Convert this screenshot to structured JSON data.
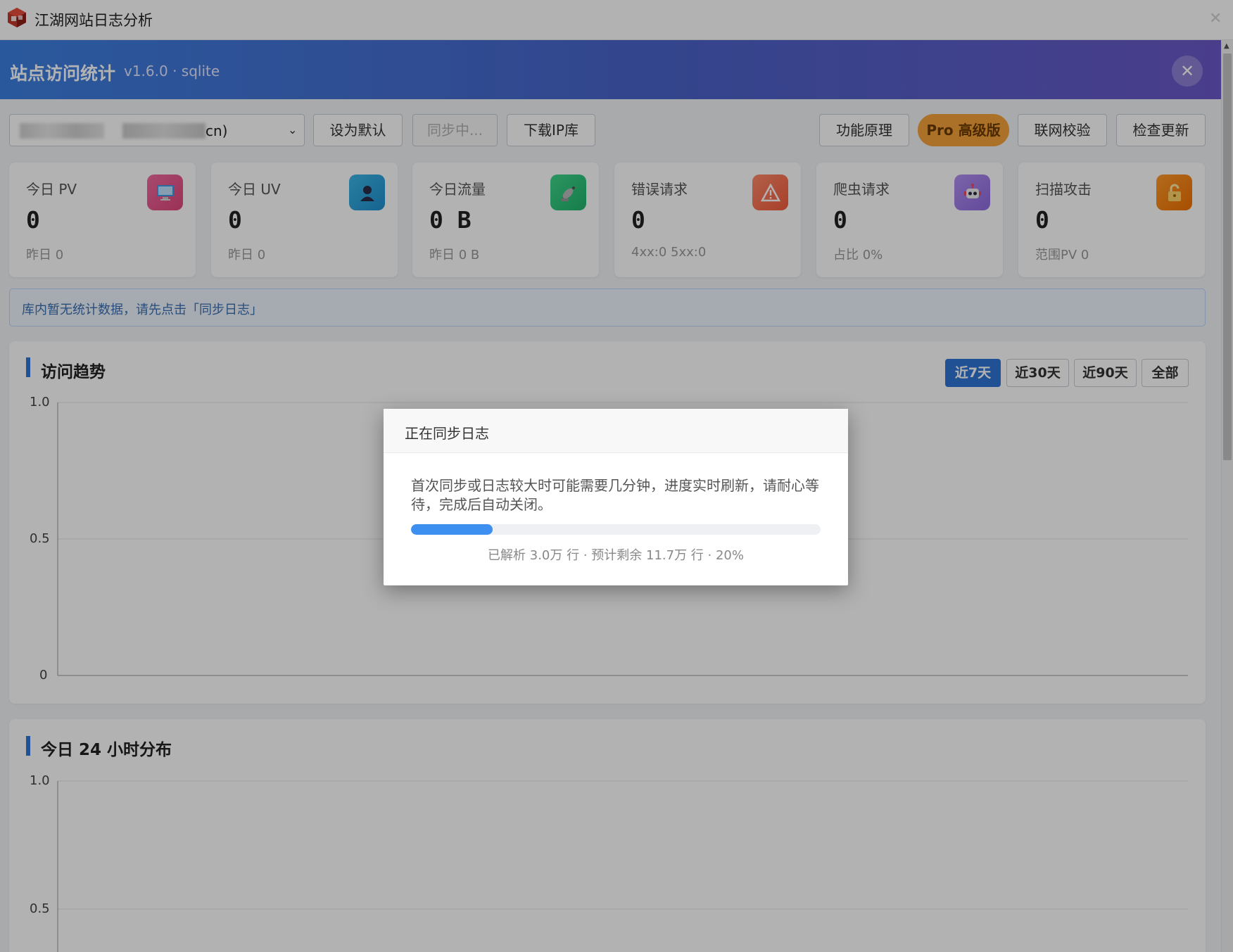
{
  "window": {
    "title": "江湖网站日志分析",
    "close_glyph": "✕",
    "logo_icon": "cube-box-icon"
  },
  "header": {
    "title": "站点访问统计",
    "version": "v1.6.0 · sqlite",
    "close_glyph": "✕",
    "gradient": [
      "#3d7fe0",
      "#6a58c8"
    ]
  },
  "toolbar": {
    "site_select_value": "cn)",
    "set_default": "设为默认",
    "syncing": "同步中...",
    "download_ip": "下载IP库",
    "how_it_works": "功能原理",
    "pro": "Pro 高级版",
    "online_verify": "联网校验",
    "check_update": "检查更新"
  },
  "stats": [
    {
      "label": "今日 PV",
      "value": "0",
      "sub": "昨日 0",
      "icon": "monitor-icon"
    },
    {
      "label": "今日 UV",
      "value": "0",
      "sub": "昨日 0",
      "icon": "user-icon"
    },
    {
      "label": "今日流量",
      "value": "0 B",
      "sub": "昨日 0 B",
      "icon": "satellite-icon"
    },
    {
      "label": "错误请求",
      "value": "0",
      "sub": "4xx:0 5xx:0",
      "icon": "warning-icon"
    },
    {
      "label": "爬虫请求",
      "value": "0",
      "sub": "占比 0%",
      "icon": "robot-icon"
    },
    {
      "label": "扫描攻击",
      "value": "0",
      "sub": "范围PV 0",
      "icon": "lock-icon"
    }
  ],
  "notice": "库内暂无统计数据，请先点击「同步日志」",
  "trend": {
    "title": "访问趋势",
    "ranges": [
      "近7天",
      "近30天",
      "近90天",
      "全部"
    ],
    "active_range": "近7天",
    "y_ticks": [
      "1.0",
      "0.5",
      "0"
    ]
  },
  "hourly": {
    "title": "今日 24 小时分布",
    "y_ticks": [
      "1.0",
      "0.5"
    ]
  },
  "modal": {
    "title": "正在同步日志",
    "message": "首次同步或日志较大时可能需要几分钟，进度实时刷新，请耐心等待，完成后自动关闭。",
    "progress_percent": 20,
    "progress_text": "已解析 3.0万 行 · 预计剩余 11.7万 行 · 20%"
  },
  "colors": {
    "accent": "#2e74d6",
    "pro": "#f5a33c",
    "progress": "#3d8ff0"
  }
}
